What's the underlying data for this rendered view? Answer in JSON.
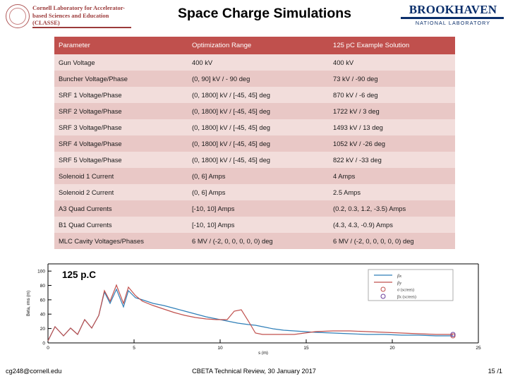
{
  "header": {
    "title": "Space Charge Simulations",
    "cornell_logo_lines": "Cornell Laboratory for Accelerator-based Sciences and Education (CLASSE)",
    "bnl_name": "BROOKHAVEN",
    "bnl_sub": "NATIONAL LABORATORY"
  },
  "table": {
    "columns": [
      "Parameter",
      "Optimization Range",
      "125 pC Example Solution"
    ],
    "rows": [
      [
        "Gun Voltage",
        "400 kV",
        "400 kV"
      ],
      [
        "Buncher Voltage/Phase",
        "(0, 90] kV / - 90 deg",
        "73 kV / -90 deg"
      ],
      [
        "SRF 1 Voltage/Phase",
        "(0, 1800] kV / [-45, 45] deg",
        "870 kV / -6 deg"
      ],
      [
        "SRF 2 Voltage/Phase",
        "(0, 1800] kV / [-45, 45] deg",
        "1722 kV / 3 deg"
      ],
      [
        "SRF 3 Voltage/Phase",
        "(0, 1800] kV / [-45, 45] deg",
        "1493 kV / 13 deg"
      ],
      [
        "SRF 4 Voltage/Phase",
        "(0, 1800] kV / [-45, 45] deg",
        "1052 kV / -26 deg"
      ],
      [
        "SRF 5 Voltage/Phase",
        "(0, 1800] kV / [-45, 45] deg",
        "822 kV / -33 deg"
      ],
      [
        "Solenoid 1 Current",
        "(0, 6] Amps",
        "4 Amps"
      ],
      [
        "Solenoid 2 Current",
        "(0, 6] Amps",
        "2.5 Amps"
      ],
      [
        "A3 Quad Currents",
        "[-10, 10] Amps",
        "(0.2, 0.3, 1.2, -3.5) Amps"
      ],
      [
        "B1 Quad Currents",
        "[-10, 10] Amps",
        "(4.3, 4.3, -0.9) Amps"
      ],
      [
        "MLC Cavity Voltages/Phases",
        "6 MV / (-2, 0, 0, 0, 0, 0) deg",
        "6 MV / (-2, 0, 0, 0, 0, 0) deg"
      ]
    ]
  },
  "plot": {
    "annotation": "125 p.C",
    "legend": [
      "βx",
      "βy",
      "σ (screen)",
      "βx (screen)"
    ]
  },
  "chart_data": {
    "type": "line",
    "title": "125 pC",
    "xlabel": "s (m)",
    "ylabel": "Beta, rms (m)",
    "xlim": [
      0,
      25
    ],
    "ylim": [
      0,
      110
    ],
    "xticks": [
      0,
      5,
      10,
      15,
      20,
      25
    ],
    "yticks": [
      0,
      20,
      40,
      60,
      80,
      100
    ],
    "series": [
      {
        "name": "βx",
        "color": "#2f7fb8",
        "x": [
          0,
          0.4,
          0.9,
          1.3,
          1.7,
          2.1,
          2.5,
          2.9,
          3.2,
          3.5,
          3.8,
          4.1,
          4.4,
          4.8,
          5.2,
          5.8,
          6.4,
          7.0,
          7.6,
          8.2,
          8.8,
          9.4,
          10.0,
          10.6,
          11.2,
          11.6,
          12.0,
          12.6,
          13.2,
          13.8,
          14.4,
          15.0,
          16.0,
          17.0,
          18.0,
          19.0,
          20.0,
          21.0,
          22.0,
          22.6,
          23.0
        ],
        "y": [
          3,
          22,
          10,
          20,
          12,
          32,
          20,
          38,
          70,
          55,
          74,
          50,
          72,
          62,
          60,
          55,
          52,
          48,
          44,
          40,
          36,
          33,
          30,
          27,
          25,
          24,
          22,
          20,
          18,
          17,
          16,
          15,
          14,
          13,
          12,
          12,
          11,
          11,
          10,
          10,
          10
        ]
      },
      {
        "name": "βy",
        "color": "#c0504d",
        "x": [
          0,
          0.4,
          0.9,
          1.3,
          1.7,
          2.1,
          2.5,
          2.9,
          3.2,
          3.5,
          3.8,
          4.1,
          4.4,
          4.8,
          5.2,
          5.8,
          6.4,
          7.0,
          7.6,
          8.2,
          8.8,
          9.4,
          10.0,
          10.4,
          10.8,
          11.2,
          11.6,
          12.0,
          12.6,
          13.2,
          13.8,
          14.4,
          15.0,
          16.0,
          17.0,
          18.0,
          19.0,
          20.0,
          21.0,
          22.0,
          22.6,
          23.0
        ],
        "y": [
          3,
          22,
          10,
          20,
          12,
          32,
          20,
          38,
          72,
          58,
          80,
          55,
          78,
          65,
          58,
          52,
          47,
          42,
          38,
          35,
          33,
          32,
          32,
          44,
          46,
          30,
          14,
          12,
          12,
          12,
          14,
          16,
          17,
          17,
          16,
          15,
          14,
          13,
          12,
          11,
          11,
          11
        ]
      }
    ],
    "markers": [
      {
        "name": "σ (screen)",
        "x": 22.6,
        "y": 10,
        "color": "#c0504d"
      },
      {
        "name": "βx (screen)",
        "x": 22.6,
        "y": 10,
        "color": "#6a3d9a"
      }
    ],
    "grid": false,
    "legend_position": "upper right"
  },
  "footer": {
    "left": "cg248@cornell.edu",
    "center": "CBETA Technical Review, 30 January 2017",
    "right": "15 /1"
  }
}
